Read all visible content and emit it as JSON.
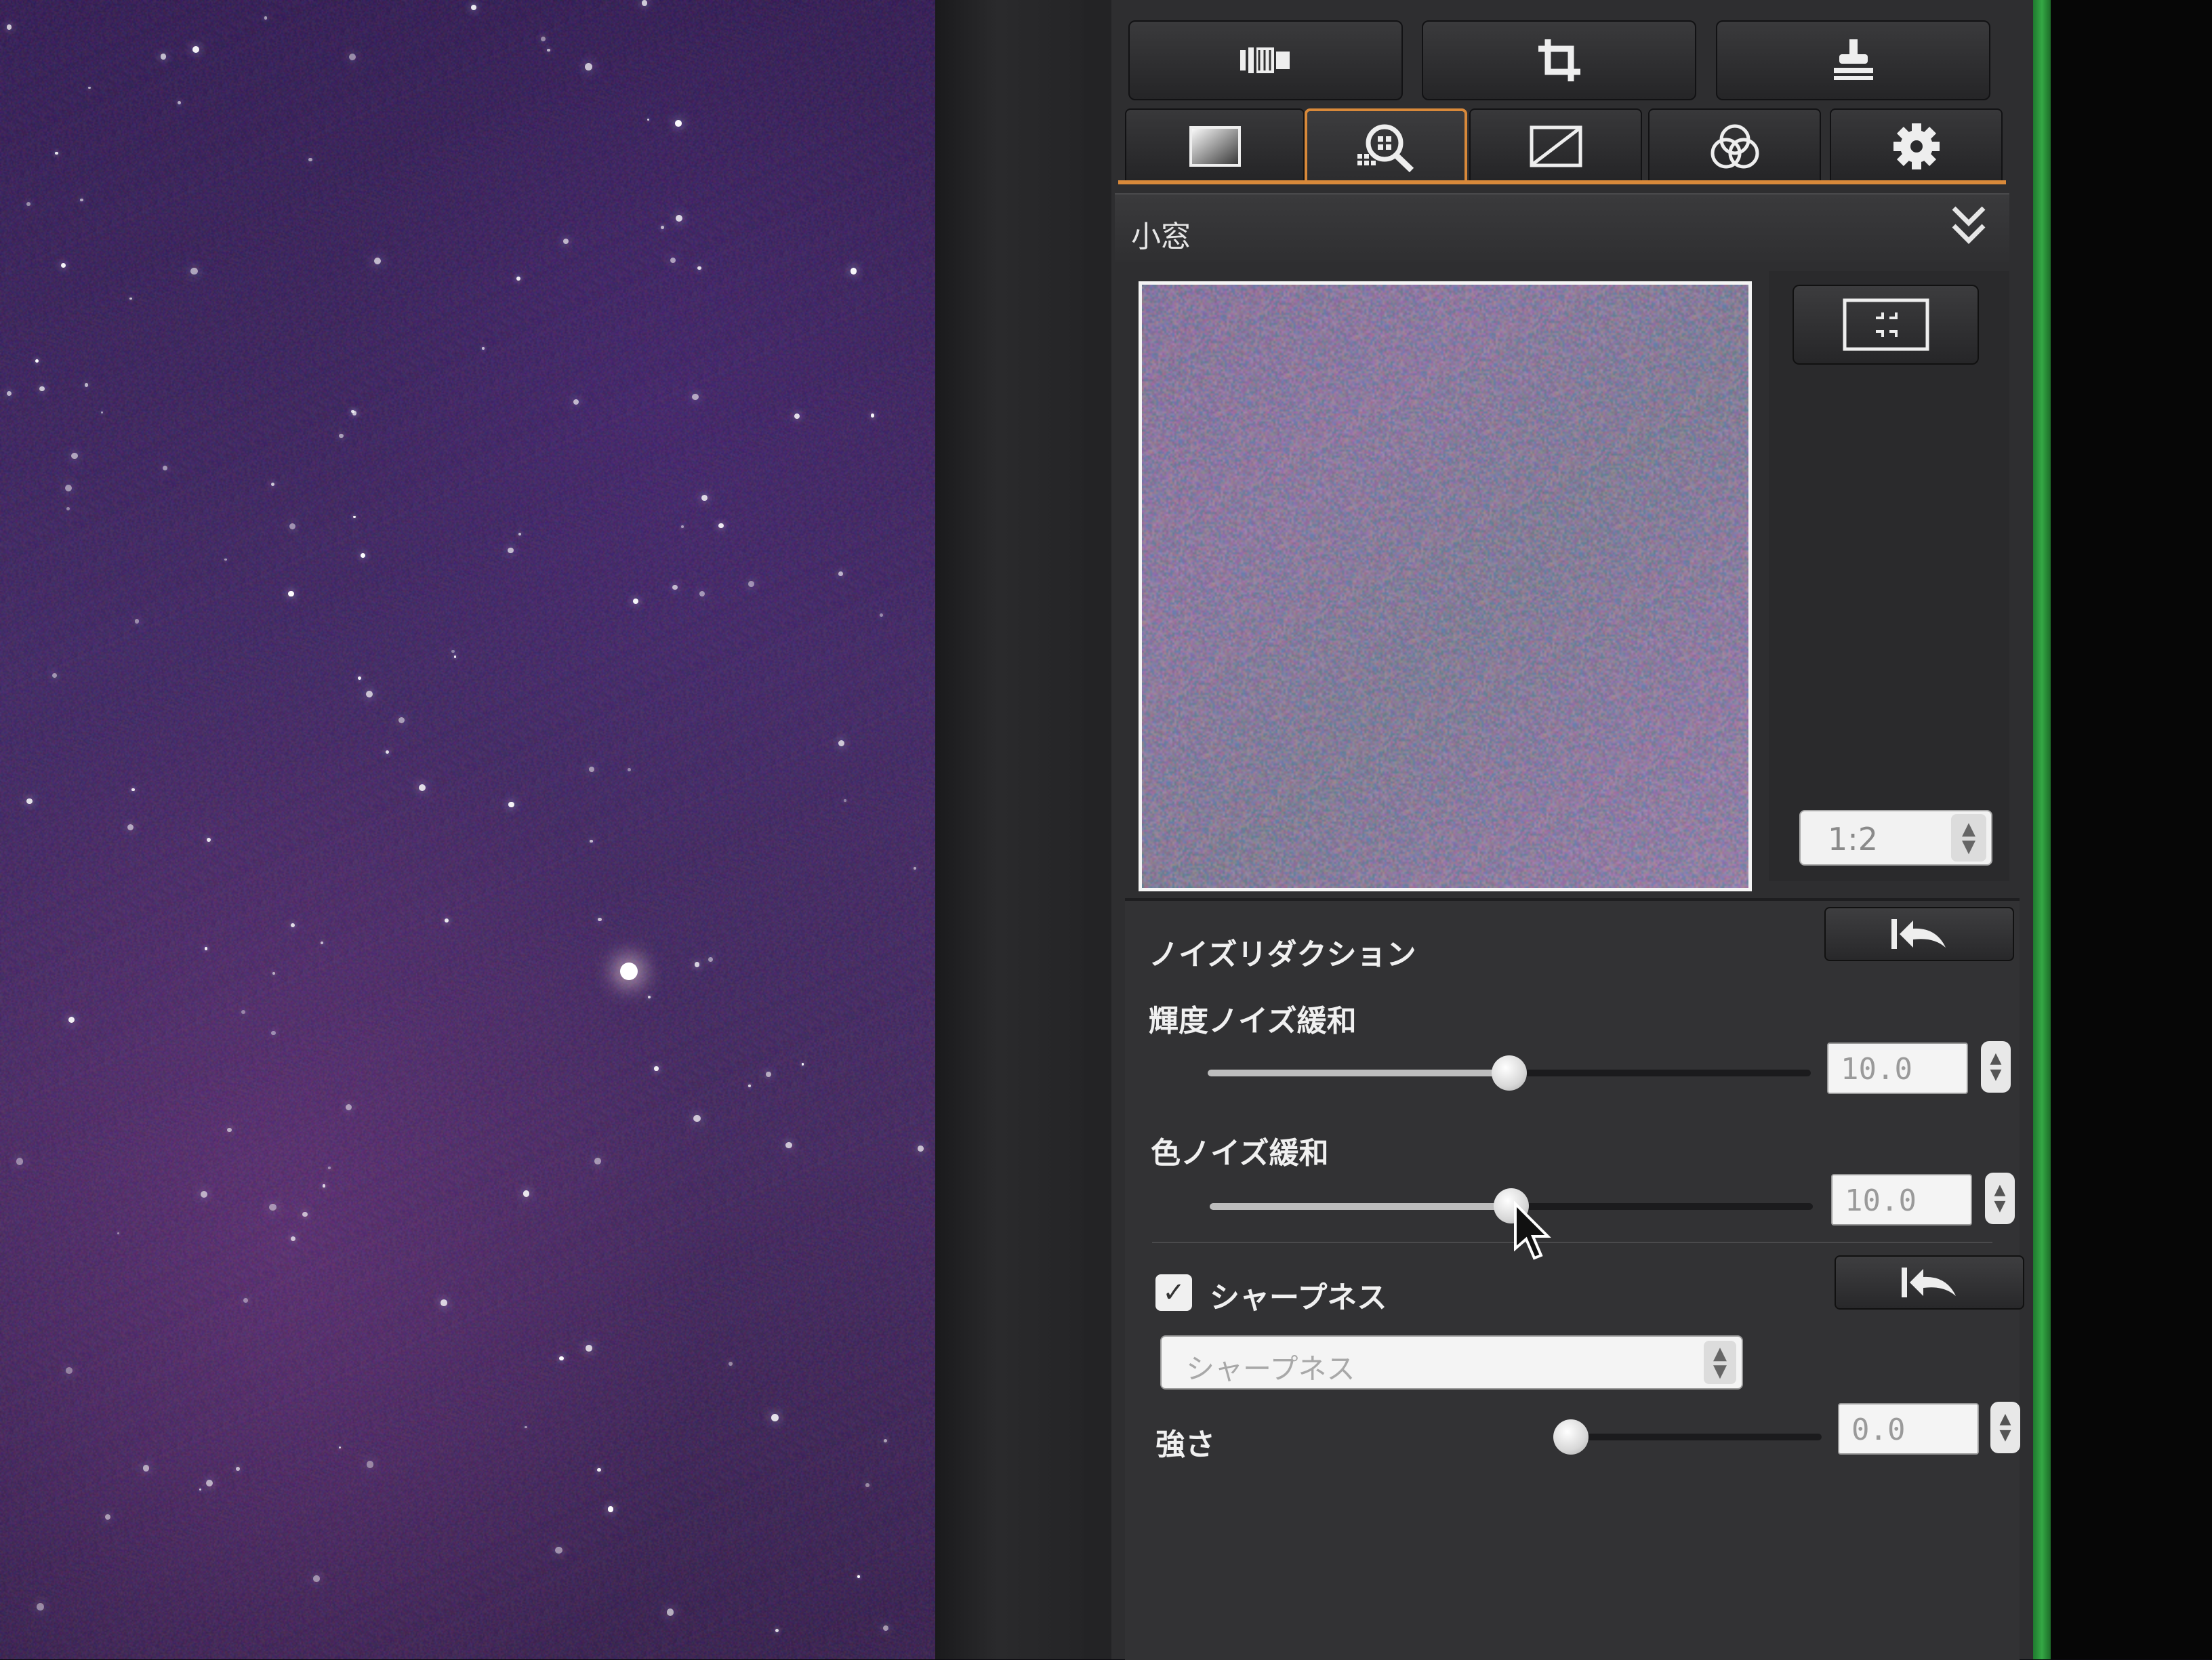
{
  "navigator": {
    "title": "小窓",
    "zoom_value": "1:2"
  },
  "noise_reduction": {
    "title": "ノイズリダクション",
    "luminance": {
      "label": "輝度ノイズ緩和",
      "value": "10.0",
      "level": 0.5
    },
    "chrominance": {
      "label": "色ノイズ緩和",
      "value": "10.0",
      "level": 0.5
    }
  },
  "sharpness": {
    "title": "シャープネス",
    "checked": true,
    "type_value": "シャープネス",
    "strength": {
      "label": "強さ",
      "value": "0.0",
      "level": 0.0
    }
  },
  "colors": {
    "accent": "#d8893a",
    "panel": "#2e2e30",
    "green_edge": "#35a845"
  },
  "icons": {
    "toolbar": [
      "lens-correction-icon",
      "crop-icon",
      "stamp-icon"
    ],
    "tabs": [
      "basic-adjust-icon",
      "detail-magnify-icon",
      "tone-curve-icon",
      "color-adjust-icon",
      "settings-gear-icon"
    ]
  }
}
